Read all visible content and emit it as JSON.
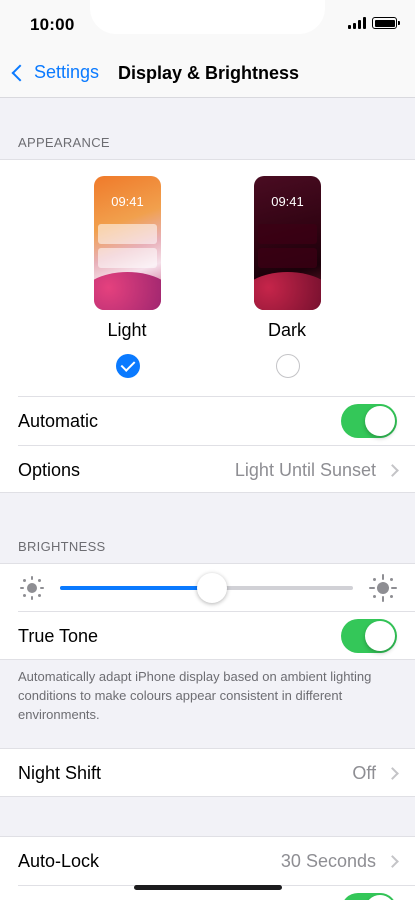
{
  "status": {
    "time": "10:00"
  },
  "nav": {
    "back_label": "Settings",
    "title": "Display & Brightness"
  },
  "appearance": {
    "header": "APPEARANCE",
    "light": {
      "label": "Light",
      "preview_time": "09:41",
      "selected": true
    },
    "dark": {
      "label": "Dark",
      "preview_time": "09:41",
      "selected": false
    },
    "automatic": {
      "label": "Automatic",
      "on": true
    },
    "options": {
      "label": "Options",
      "value": "Light Until Sunset"
    }
  },
  "brightness": {
    "header": "BRIGHTNESS",
    "level": 0.52,
    "true_tone": {
      "label": "True Tone",
      "on": true
    },
    "footer": "Automatically adapt iPhone display based on ambient lighting conditions to make colours appear consistent in different environments."
  },
  "night_shift": {
    "label": "Night Shift",
    "value": "Off"
  },
  "auto_lock": {
    "label": "Auto-Lock",
    "value": "30 Seconds"
  },
  "colors": {
    "accent": "#0a7aff",
    "toggle_on": "#34c759",
    "secondary_text": "#8e8e93"
  }
}
